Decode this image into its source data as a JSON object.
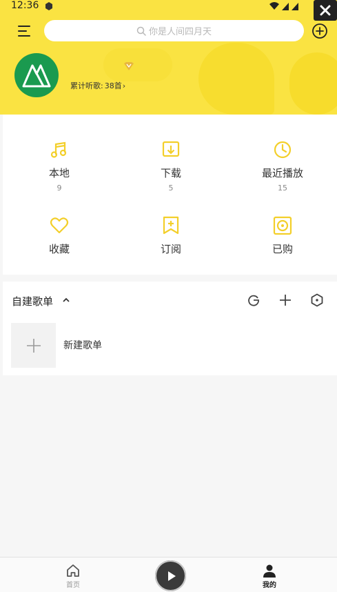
{
  "status": {
    "time": "12:36"
  },
  "search": {
    "placeholder": "你是人间四月天"
  },
  "profile": {
    "listen_label": "累计听歌:",
    "listen_count": "38首"
  },
  "quick": [
    {
      "label": "本地",
      "count": "9",
      "icon": "music-note-icon"
    },
    {
      "label": "下载",
      "count": "5",
      "icon": "download-icon"
    },
    {
      "label": "最近播放",
      "count": "15",
      "icon": "clock-icon"
    },
    {
      "label": "收藏",
      "icon": "heart-icon"
    },
    {
      "label": "订阅",
      "icon": "bookmark-plus-icon"
    },
    {
      "label": "已购",
      "icon": "purchased-disc-icon"
    }
  ],
  "playlist": {
    "title": "自建歌单",
    "new_label": "新建歌单",
    "tools": [
      "refresh-icon",
      "plus-icon",
      "settings-icon"
    ]
  },
  "bottom_nav": {
    "home_label": "首页",
    "mine_label": "我的"
  },
  "colors": {
    "accent": "#fae342",
    "icon_yellow": "#f3cf2a",
    "avatar_green": "#1a9a4f"
  }
}
